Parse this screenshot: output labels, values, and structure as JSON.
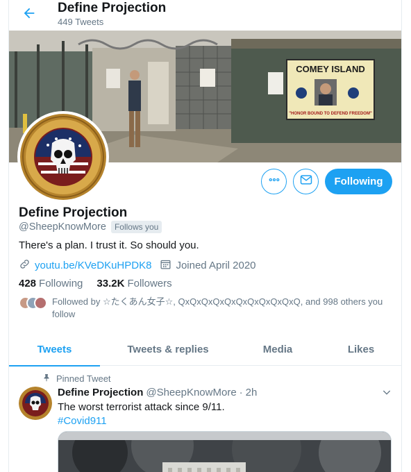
{
  "header": {
    "title": "Define Projection",
    "tweet_count": "449 Tweets"
  },
  "banner": {
    "sign_title": "COMEY ISLAND",
    "sign_motto": "\"HONOR BOUND TO DEFEND FREEDOM\""
  },
  "actions": {
    "more_icon": "more-icon",
    "message_icon": "envelope-icon",
    "follow_label": "Following"
  },
  "profile": {
    "name": "Define Projection",
    "handle": "@SheepKnowMore",
    "follows_you": "Follows you",
    "bio": "There's a plan. I trust it. So should you.",
    "link": "youtu.be/KVeDKuHPDK8",
    "joined": "Joined April 2020",
    "following_count": "428",
    "following_label": "Following",
    "followers_count": "33.2K",
    "followers_label": "Followers",
    "followed_by": "Followed by ☆たくあん女子☆, QxQxQxQxQxQxQxQxQxQxQ, and 998 others you follow"
  },
  "tabs": [
    {
      "label": "Tweets",
      "active": true
    },
    {
      "label": "Tweets & replies",
      "active": false
    },
    {
      "label": "Media",
      "active": false
    },
    {
      "label": "Likes",
      "active": false
    }
  ],
  "tweet": {
    "pinned_label": "Pinned Tweet",
    "author_name": "Define Projection",
    "author_handle": "@SheepKnowMore",
    "separator": "·",
    "time": "2h",
    "text": "The worst terrorist attack since 9/11.",
    "hashtag": "#Covid911"
  },
  "colors": {
    "accent": "#1da1f2",
    "secondary_text": "#657786",
    "primary_text": "#14171a"
  }
}
